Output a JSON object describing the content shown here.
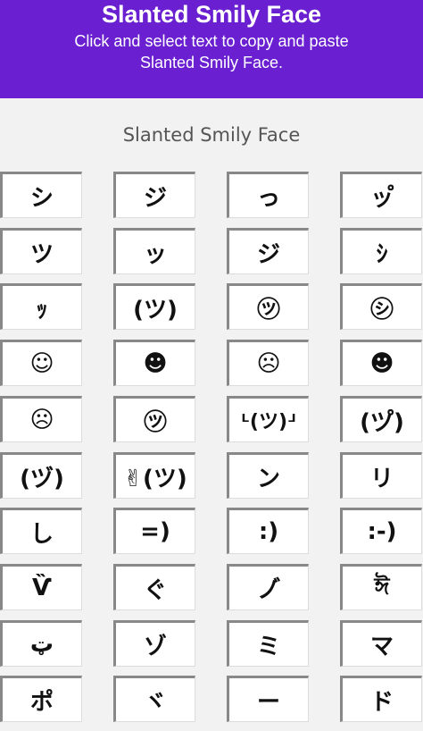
{
  "header": {
    "title": "Slanted Smily Face",
    "subtitle_line1": "Click and select text to copy and paste",
    "subtitle_line2": "Slanted Smily Face."
  },
  "section": {
    "title": "Slanted Smily Face"
  },
  "faces": [
    [
      "シ",
      "ジ",
      "っ",
      "ッ゚"
    ],
    [
      "ツ",
      "ッ",
      "ジ",
      "ｼ"
    ],
    [
      "ｯ",
      "(ツ)",
      "㋡",
      "㋛"
    ],
    [
      "☺",
      "☻",
      "☹",
      "☻"
    ],
    [
      "☹",
      "㋡",
      "ᒻ(ツ)ᒽ",
      "(ツ゚)"
    ],
    [
      "(ヅ)",
      "✌(ツ)",
      "ン",
      "リ"
    ],
    [
      "し",
      "=)",
      ":)",
      ":-)"
    ],
    [
      "Ѷ",
      "ぐ",
      "ノ゙",
      "ঈ"
    ],
    [
      "ټ",
      "ゾ",
      "ミ",
      "マ"
    ],
    [
      "ポ",
      "ヾ",
      "ー",
      "ド"
    ]
  ],
  "colors": {
    "header_bg": "#6a1fd1",
    "page_bg": "#f2f2f2"
  }
}
